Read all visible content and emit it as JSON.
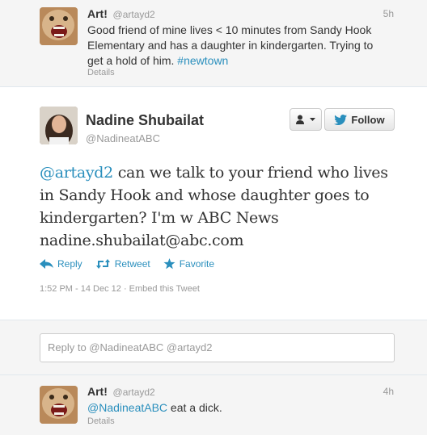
{
  "tweets_above": {
    "name": "Art!",
    "handle": "@artayd2",
    "time": "5h",
    "text_line1": "Good friend of mine lives < 10 minutes from Sandy Hook",
    "text_line2": "Elementary and has a daughter in kindergarten. Trying to",
    "text_line3_prefix": "get a hold of him. ",
    "hashtag": "#newtown",
    "details": "Details"
  },
  "main_tweet": {
    "name": "Nadine Shubailat",
    "handle": "@NadineatABC",
    "follow_label": "Follow",
    "mention": "@artayd2",
    "text_rest": " can we talk to your friend who lives in Sandy Hook and whose daughter goes to kindergarten? I'm w ABC News nadine.shubailat@abc.com",
    "reply_label": "Reply",
    "retweet_label": "Retweet",
    "favorite_label": "Favorite",
    "timestamp": "1:52 PM - 14 Dec 12 · Embed this Tweet",
    "colors": {
      "link": "#2a8fbd",
      "twitter_bird": "#2a8fbd"
    }
  },
  "reply_box": {
    "placeholder": "Reply to @NadineatABC @artayd2"
  },
  "tweets_below": {
    "name": "Art!",
    "handle": "@artayd2",
    "time": "4h",
    "mention": "@NadineatABC",
    "text_rest": " eat a dick.",
    "details": "Details"
  }
}
